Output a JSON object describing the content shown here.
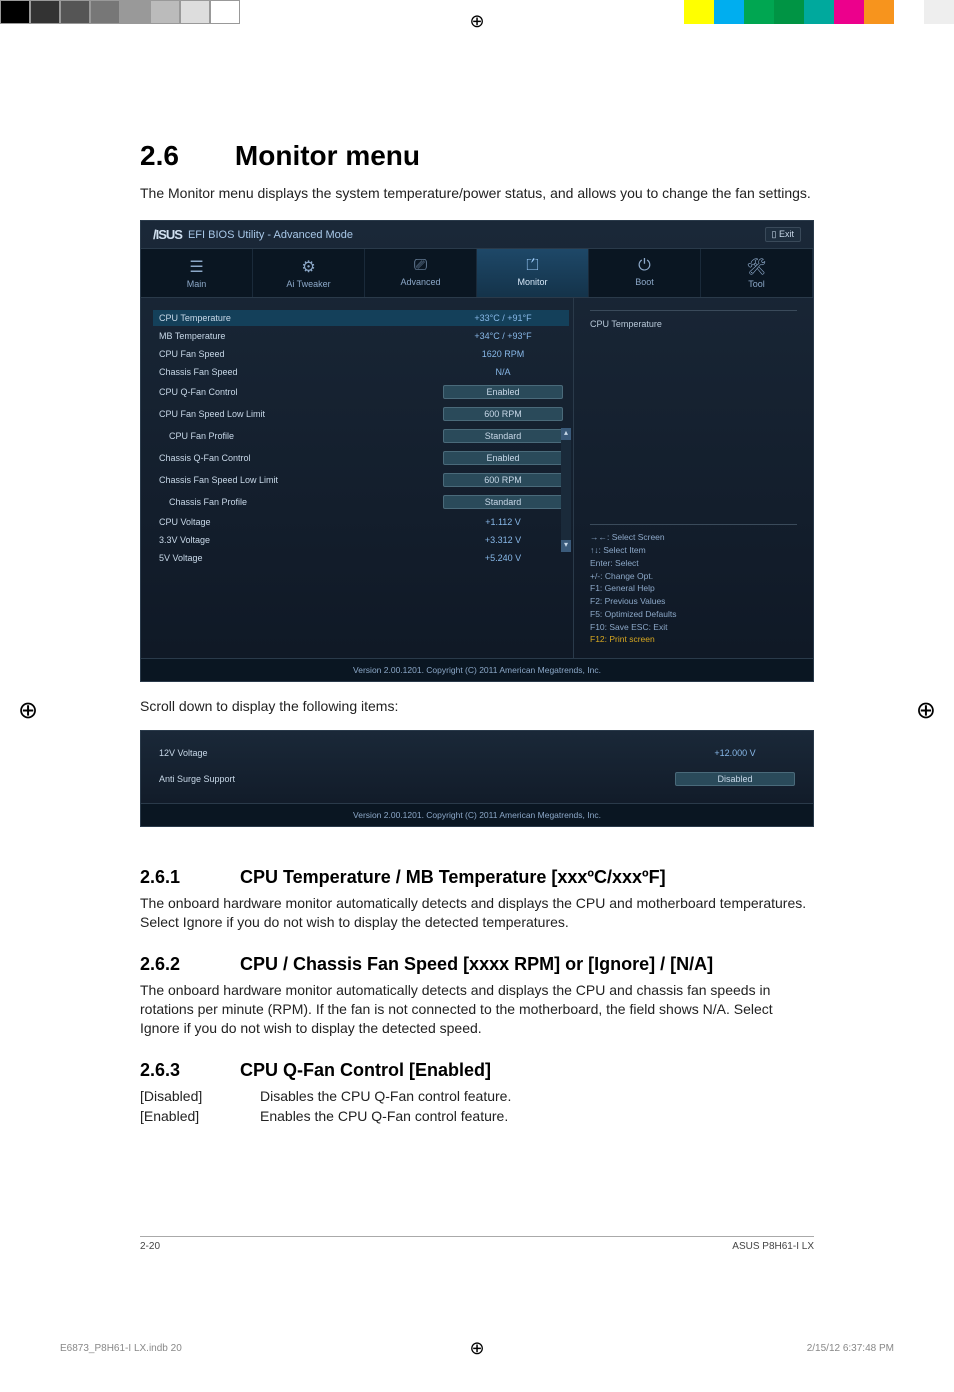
{
  "top_colors_left": [
    "#000000",
    "#333333",
    "#555555",
    "#777777",
    "#999999",
    "#bbbbbb",
    "#dddddd",
    "#ffffff"
  ],
  "top_colors_right": [
    "#ffff00",
    "#00aeef",
    "#00a651",
    "#009444",
    "#00a99d",
    "#ec008c",
    "#f7941d",
    "#fff",
    "#eee"
  ],
  "heading": "2.6  Monitor menu",
  "intro": "The Monitor menu displays the system temperature/power status, and allows you to change the fan settings.",
  "bios": {
    "logo": "/ISUS",
    "title": "EFI BIOS Utility - Advanced Mode",
    "exit": "Exit",
    "tabs": [
      {
        "icon": "☰",
        "label": "Main"
      },
      {
        "icon": "⚙",
        "label": "Ai Tweaker"
      },
      {
        "icon": "⎚",
        "label": "Advanced"
      },
      {
        "icon": "⏍",
        "label": "Monitor",
        "active": true
      },
      {
        "icon": "⏻",
        "label": "Boot"
      },
      {
        "icon": "🛠",
        "label": "Tool"
      }
    ],
    "rows": [
      {
        "label": "CPU Temperature",
        "value": "+33°C / +91°F",
        "selected": true,
        "type": "text"
      },
      {
        "label": "MB Temperature",
        "value": "+34°C / +93°F",
        "type": "text"
      },
      {
        "label": "CPU Fan Speed",
        "value": "1620 RPM",
        "type": "text"
      },
      {
        "label": "Chassis Fan Speed",
        "value": "N/A",
        "type": "text"
      },
      {
        "label": "CPU Q-Fan Control",
        "value": "Enabled",
        "type": "select"
      },
      {
        "label": "CPU Fan Speed Low Limit",
        "value": "600 RPM",
        "type": "select"
      },
      {
        "label": "CPU Fan Profile",
        "value": "Standard",
        "type": "select",
        "indent": true
      },
      {
        "label": "Chassis Q-Fan Control",
        "value": "Enabled",
        "type": "select"
      },
      {
        "label": "Chassis Fan Speed Low Limit",
        "value": "600 RPM",
        "type": "select"
      },
      {
        "label": "Chassis Fan Profile",
        "value": "Standard",
        "type": "select",
        "indent": true
      },
      {
        "label": "CPU Voltage",
        "value": "+1.112 V",
        "type": "text"
      },
      {
        "label": "3.3V Voltage",
        "value": "+3.312 V",
        "type": "text"
      },
      {
        "label": "5V Voltage",
        "value": "+5.240 V",
        "type": "text"
      }
    ],
    "help_title": "CPU Temperature",
    "help_keys": [
      "→←:  Select Screen",
      "↑↓:  Select Item",
      "Enter:  Select",
      "+/-:  Change Opt.",
      "F1:  General Help",
      "F2:  Previous Values",
      "F5:  Optimized Defaults",
      "F10:  Save   ESC:  Exit"
    ],
    "help_highlight": "F12: Print screen",
    "footer": "Version  2.00.1201.   Copyright  (C)  2011  American  Megatrends,  Inc."
  },
  "scroll_text": "Scroll down to display the following items:",
  "bios2_rows": [
    {
      "label": "12V Voltage",
      "value": "+12.000 V",
      "type": "text"
    },
    {
      "label": "Anti Surge Support",
      "value": "Disabled",
      "type": "select"
    }
  ],
  "bios2_footer": "Version  2.00.1201.   Copyright  (C)  2011  American  Megatrends,  Inc.",
  "s261": {
    "num": "2.6.1",
    "title": "CPU Temperature / MB Temperature [xxxºC/xxxºF]",
    "body": "The onboard hardware monitor automatically detects and displays the CPU and motherboard temperatures. Select Ignore if you do not wish to display the detected temperatures."
  },
  "s262": {
    "num": "2.6.2",
    "title": "CPU / Chassis Fan Speed [xxxx RPM] or [Ignore] / [N/A]",
    "body": "The onboard hardware monitor automatically detects and displays the CPU and chassis fan speeds in rotations per minute (RPM). If the fan is not connected to the motherboard, the field shows N/A. Select Ignore if you do not wish to display the detected speed."
  },
  "s263": {
    "num": "2.6.3",
    "title": "CPU Q-Fan Control [Enabled]",
    "options": [
      {
        "key": "[Disabled]",
        "desc": "Disables the CPU Q-Fan control feature."
      },
      {
        "key": "[Enabled]",
        "desc": "Enables the CPU Q-Fan control feature."
      }
    ]
  },
  "footer": {
    "page": "2-20",
    "model": "ASUS P8H61-I LX"
  },
  "print": {
    "file": "E6873_P8H61-I LX.indb   20",
    "date": "2/15/12   6:37:48 PM"
  }
}
